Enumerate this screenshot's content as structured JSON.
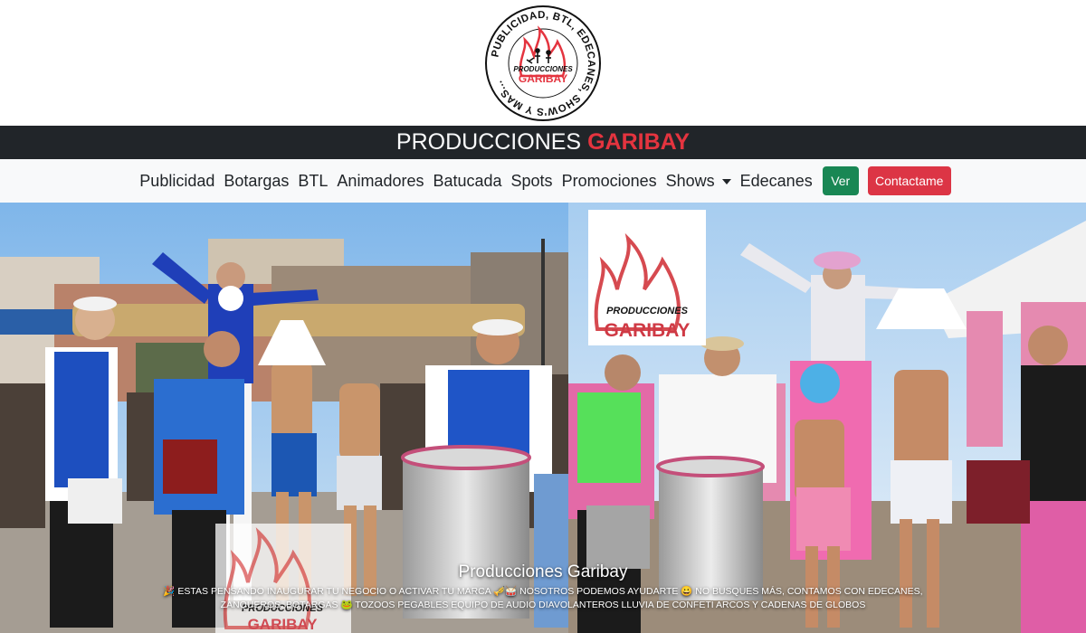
{
  "logo": {
    "ring_text": "PUBLICIDAD, BTL, EDECANES, SHOW'S Y MAS...",
    "inner_top": "PRODUCCIONES",
    "inner_bottom": "GARIBAY"
  },
  "brand": {
    "main": "PRODUCCIONES",
    "accent": "GARIBAY"
  },
  "nav": {
    "items": [
      "Publicidad",
      "Botargas",
      "BTL",
      "Animadores",
      "Batucada",
      "Spots",
      "Promociones",
      "Shows",
      "Edecanes"
    ],
    "ver_label": "Ver",
    "contact_label": "Contactame"
  },
  "carousel": {
    "watermark_top": "PRODUCCIONES",
    "watermark_bottom": "GARIBAY",
    "banner_top": "PRODUCCIONES",
    "banner_bottom": "GARIBAY",
    "caption_title": "Producciones Garibay",
    "caption_text": "🎉 ESTAS PENSANDO INAUGURAR TU NEGOCIO O ACTIVAR TU MARCA 🎺🥁 NOSOTROS PODEMOS AYUDARTE 😀 NO BUSQUES MÁS, CONTAMOS CON EDECANES, ZANQUEROS, BOTARGAS 🐸 TOZOOS PEGABLES EQUIPO DE AUDIO DIAVOLANTEROS LLUVIA DE CONFETI ARCOS Y CADENAS DE GLOBOS"
  },
  "colors": {
    "brand_bar_bg": "#212529",
    "brand_accent": "#e4343f",
    "nav_bg": "#f8f9fa",
    "ver_button": "#198754",
    "contact_button": "#dc3545"
  }
}
